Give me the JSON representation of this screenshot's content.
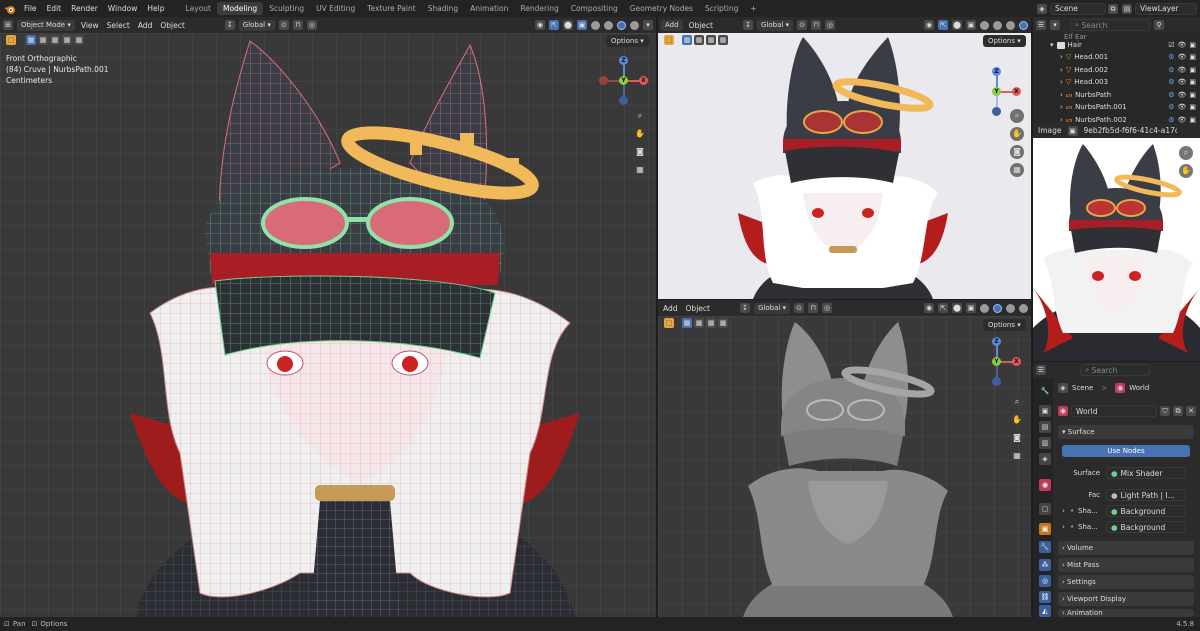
{
  "menu": [
    "File",
    "Edit",
    "Render",
    "Window",
    "Help"
  ],
  "workspaces": [
    {
      "label": "Layout",
      "active": false
    },
    {
      "label": "Modeling",
      "active": true
    },
    {
      "label": "Sculpting",
      "active": false
    },
    {
      "label": "UV Editing",
      "active": false
    },
    {
      "label": "Texture Paint",
      "active": false
    },
    {
      "label": "Shading",
      "active": false
    },
    {
      "label": "Animation",
      "active": false
    },
    {
      "label": "Rendering",
      "active": false
    },
    {
      "label": "Compositing",
      "active": false
    },
    {
      "label": "Geometry Nodes",
      "active": false
    },
    {
      "label": "Scripting",
      "active": false
    }
  ],
  "add_workspace": "+",
  "scene": "Scene",
  "view_layer": "ViewLayer",
  "main_vp": {
    "mode": "Object Mode",
    "menus": [
      "View",
      "Select",
      "Add",
      "Object"
    ],
    "transform": "Global",
    "options": "Options",
    "info_line1": "Front Orthographic",
    "info_line2": "(84) Cruve | NurbsPath.001",
    "info_line3": "Centimeters"
  },
  "top_right_vp": {
    "menus": [
      "Add",
      "Object"
    ],
    "transform": "Global",
    "options": "Options"
  },
  "bottom_right_vp": {
    "menus": [
      "Add",
      "Object"
    ],
    "transform": "Global",
    "options": "Options"
  },
  "outliner": {
    "search_placeholder": "Search",
    "partial_item": "Elf Ear",
    "collection": "Hair",
    "items": [
      "Head.001",
      "Head.002",
      "Head.003",
      "NurbsPath",
      "NurbsPath.001",
      "NurbsPath.002"
    ]
  },
  "image_editor": {
    "label": "Image",
    "image_name": "9eb2fb5d-f6f6-41c4-a17c-6"
  },
  "properties": {
    "search_placeholder": "Search",
    "breadcrumb_scene": "Scene",
    "breadcrumb_sep": ">",
    "breadcrumb_world": "World",
    "world_name": "World",
    "surface_header": "Surface",
    "use_nodes": "Use Nodes",
    "surface_label": "Surface",
    "surface_value": "Mix Shader",
    "fac_label": "Fac",
    "fac_value": "Light Path | I...",
    "shader1_label": "Sha...",
    "shader1_value": "Background",
    "shader2_label": "Sha...",
    "shader2_value": "Background",
    "panels": [
      "Volume",
      "Mist Pass",
      "Settings",
      "Viewport Display",
      "Animation"
    ]
  },
  "status": {
    "pan": "Pan",
    "options": "Options",
    "version": "4.5.8"
  },
  "colors": {
    "accent": "#4772b3",
    "grid_bg": "#393939",
    "panel_bg": "#2b2b2b",
    "hat": "#3a3d45",
    "hair_red": "#b51c1c",
    "goggle": "#e2727a",
    "gear": "#f1b95a"
  }
}
